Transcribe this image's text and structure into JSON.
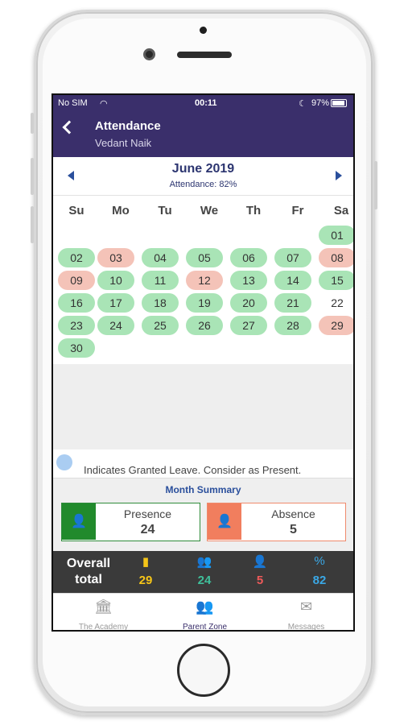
{
  "status": {
    "carrier": "No SIM",
    "time": "00:11",
    "battery": "97%"
  },
  "header": {
    "title": "Attendance",
    "subtitle": "Vedant Naik"
  },
  "month": {
    "title": "June 2019",
    "attendance": "Attendance: 82%"
  },
  "weekdays": [
    "Su",
    "Mo",
    "Tu",
    "We",
    "Th",
    "Fr",
    "Sa"
  ],
  "days": [
    {
      "label": "01",
      "status": "present"
    },
    {
      "label": "02",
      "status": "present"
    },
    {
      "label": "03",
      "status": "absent"
    },
    {
      "label": "04",
      "status": "present"
    },
    {
      "label": "05",
      "status": "present"
    },
    {
      "label": "06",
      "status": "present"
    },
    {
      "label": "07",
      "status": "present"
    },
    {
      "label": "08",
      "status": "absent"
    },
    {
      "label": "09",
      "status": "absent"
    },
    {
      "label": "10",
      "status": "present"
    },
    {
      "label": "11",
      "status": "present"
    },
    {
      "label": "12",
      "status": "absent"
    },
    {
      "label": "13",
      "status": "present"
    },
    {
      "label": "14",
      "status": "present"
    },
    {
      "label": "15",
      "status": "present"
    },
    {
      "label": "16",
      "status": "present"
    },
    {
      "label": "17",
      "status": "present"
    },
    {
      "label": "18",
      "status": "present"
    },
    {
      "label": "19",
      "status": "present"
    },
    {
      "label": "20",
      "status": "present"
    },
    {
      "label": "21",
      "status": "present"
    },
    {
      "label": "22",
      "status": "none"
    },
    {
      "label": "23",
      "status": "present"
    },
    {
      "label": "24",
      "status": "present"
    },
    {
      "label": "25",
      "status": "present"
    },
    {
      "label": "26",
      "status": "present"
    },
    {
      "label": "27",
      "status": "present"
    },
    {
      "label": "28",
      "status": "present"
    },
    {
      "label": "29",
      "status": "absent"
    },
    {
      "label": "30",
      "status": "present"
    }
  ],
  "first_weekday_index": 6,
  "legend": {
    "text": "Indicates Granted Leave. Consider as Present."
  },
  "summary": {
    "title": "Month Summary",
    "presence": {
      "label": "Presence",
      "value": "24"
    },
    "absence": {
      "label": "Absence",
      "value": "5"
    }
  },
  "overall": {
    "label_line1": "Overall",
    "label_line2": "total",
    "stats": [
      {
        "icon": "calendar-icon",
        "glyph": "▮",
        "value": "29",
        "color": "#f5c518"
      },
      {
        "icon": "user-check-icon",
        "glyph": "👥",
        "value": "24",
        "color": "#3fbf9a"
      },
      {
        "icon": "user-minus-icon",
        "glyph": "👤",
        "value": "5",
        "color": "#ef5a5a"
      },
      {
        "icon": "percent-icon",
        "glyph": "%",
        "value": "82",
        "color": "#3aa8e6"
      }
    ]
  },
  "tabs": [
    {
      "icon": "academy-icon",
      "glyph": "🏛",
      "label": "The Academy",
      "active": false
    },
    {
      "icon": "parent-zone-icon",
      "glyph": "👥",
      "label": "Parent Zone",
      "active": true
    },
    {
      "icon": "messages-icon",
      "glyph": "✉",
      "label": "Messages",
      "active": false
    }
  ],
  "colors": {
    "header": "#3a2f6b",
    "present": "#a9e4b6",
    "absent": "#f4c3b8",
    "accent": "#2a4f9c"
  }
}
